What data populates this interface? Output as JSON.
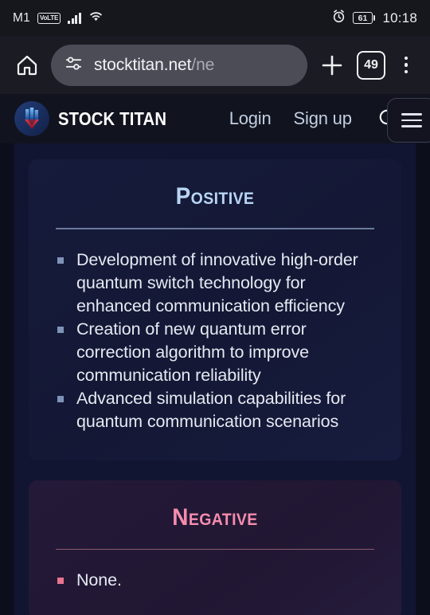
{
  "status_bar": {
    "carrier": "M1",
    "network_badge": "VoLTE",
    "signal_icon": "signal-bars-icon",
    "wifi_icon": "wifi-icon",
    "alarm_icon": "alarm-clock-icon",
    "battery_percent": "61",
    "time": "10:18"
  },
  "browser": {
    "home_icon": "home-icon",
    "url_icon": "tune-settings-icon",
    "url_main": "stocktitan.net",
    "url_trail": "/ne",
    "new_tab_icon": "plus-icon",
    "tab_count": "49",
    "overflow_icon": "three-dot-menu-icon"
  },
  "site_header": {
    "logo_icon": "stock-titan-logo-icon",
    "brand": "STOCK TITAN",
    "nav": [
      {
        "label": "Login"
      },
      {
        "label": "Sign up"
      }
    ],
    "search_icon": "search-icon",
    "menu_icon": "hamburger-menu-icon"
  },
  "content": {
    "cards": [
      {
        "title": "Positive",
        "accent": "#b8d5f5",
        "points": [
          "Development of innovative high-order quantum switch technology for enhanced communication efficiency",
          "Creation of new quantum error correction algorithm to improve communication reliability",
          "Advanced simulation capabilities for quantum communication scenarios"
        ]
      },
      {
        "title": "Negative",
        "accent": "#f58cae",
        "points": [
          "None."
        ]
      }
    ]
  }
}
